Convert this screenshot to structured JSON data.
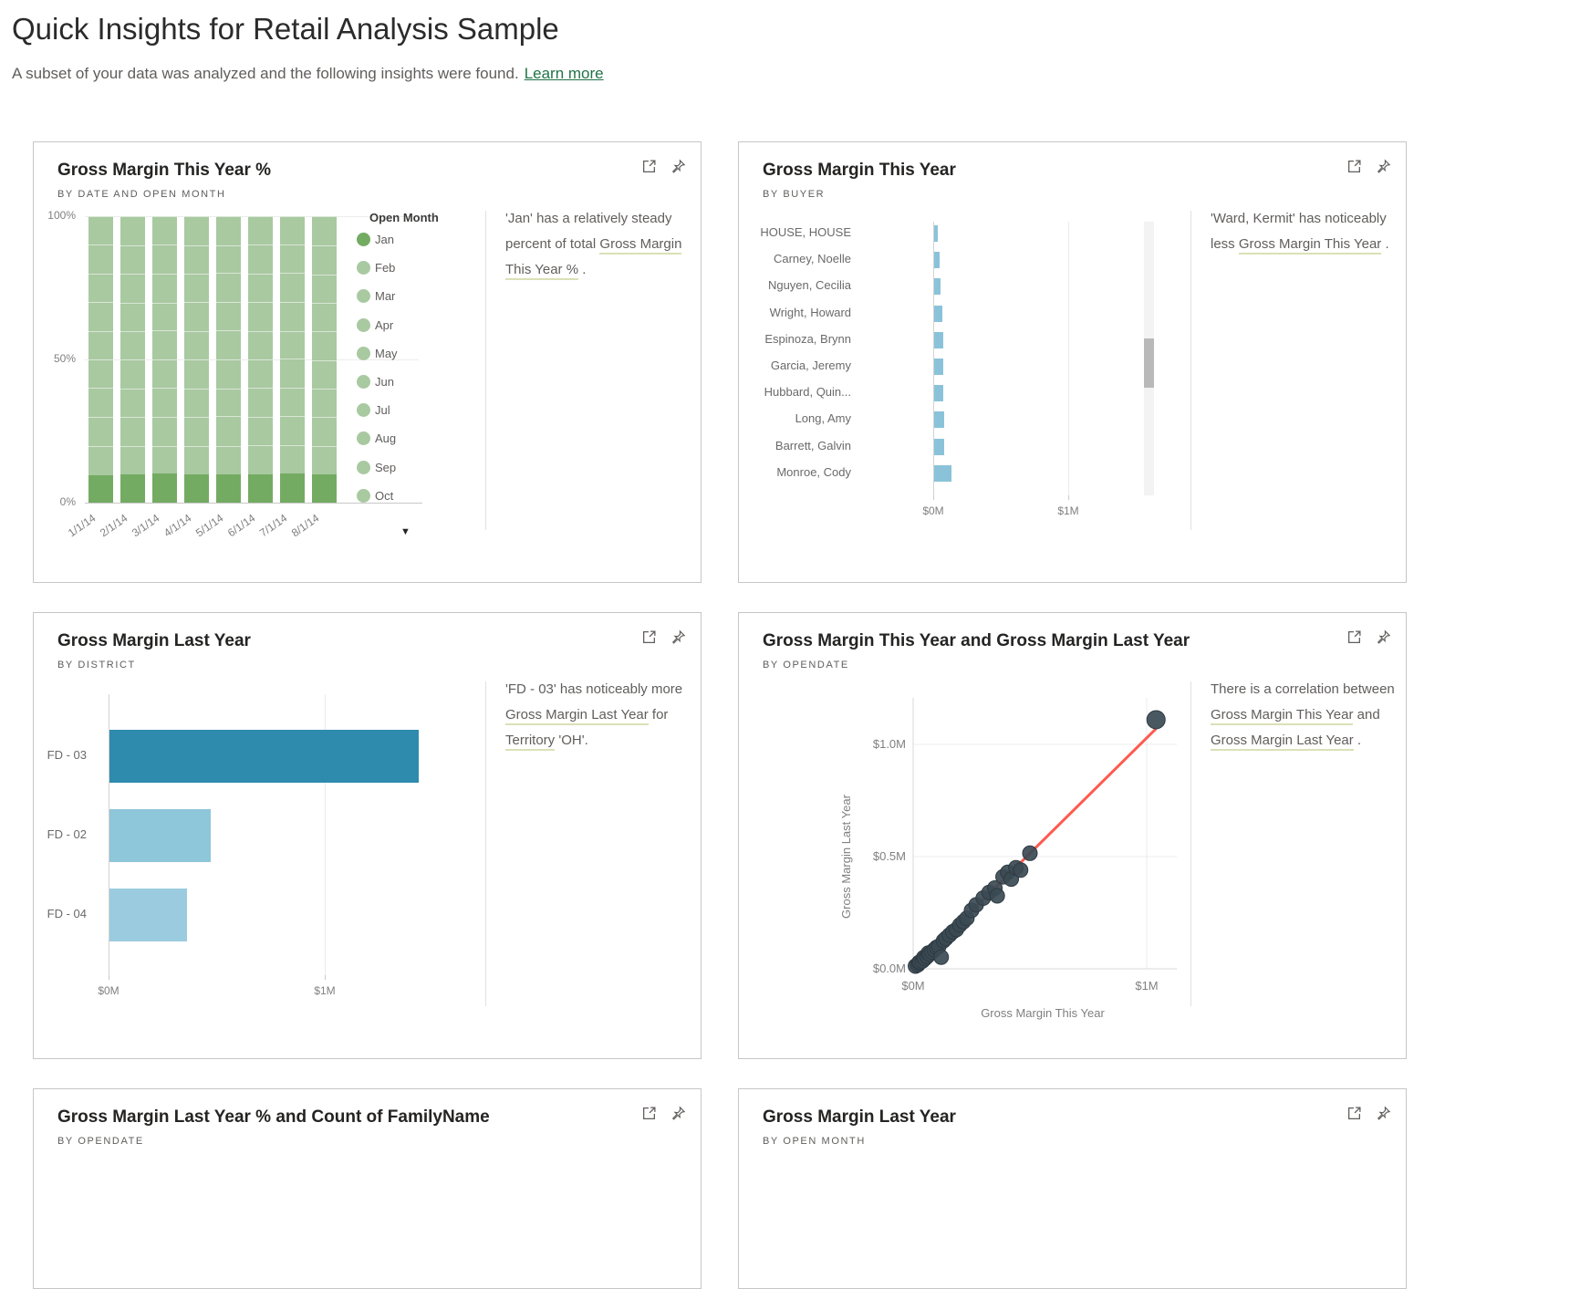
{
  "page": {
    "title": "Quick Insights for Retail Analysis Sample",
    "subtitle": "A subset of your data was analyzed and the following insights were found.",
    "learn_more_label": "Learn more"
  },
  "cards": [
    {
      "title": "Gross Margin This Year %",
      "subtitle": "BY DATE AND OPEN MONTH",
      "insight": [
        {
          "t": "'Jan' has a relatively steady percent of total "
        },
        {
          "t": "Gross Margin This Year %",
          "u": true
        },
        {
          "t": " ."
        }
      ],
      "chart_data": {
        "type": "bar",
        "subtype": "stacked-100",
        "categories": [
          "1/1/14",
          "2/1/14",
          "3/1/14",
          "4/1/14",
          "5/1/14",
          "6/1/14",
          "7/1/14",
          "8/1/14"
        ],
        "legend_title": "Open Month",
        "series": [
          "Jan",
          "Feb",
          "Mar",
          "Apr",
          "May",
          "Jun",
          "Jul",
          "Aug",
          "Sep",
          "Oct"
        ],
        "legend_has_more": true,
        "legend_more_glyph": "▼",
        "yticks": [
          "100%",
          "50%",
          "0%"
        ],
        "highlight_series": "Jan",
        "highlight_color": "#74ab63",
        "base_color": "#a9c9a1",
        "segments_pct": [
          [
            9.7,
            10.2,
            9.9,
            10.3,
            10.0,
            9.8,
            10.1,
            9.9,
            10.2,
            9.9
          ],
          [
            9.9,
            10.0,
            10.1,
            9.8,
            10.2,
            10.0,
            9.9,
            10.1,
            9.8,
            10.2
          ],
          [
            10.1,
            9.8,
            10.0,
            10.2,
            9.9,
            10.1,
            9.8,
            10.0,
            10.2,
            9.9
          ],
          [
            9.8,
            10.1,
            9.9,
            10.0,
            10.1,
            9.9,
            10.2,
            9.8,
            10.0,
            10.2
          ],
          [
            10.0,
            9.9,
            10.2,
            9.8,
            10.0,
            10.2,
            9.9,
            10.1,
            9.8,
            10.1
          ],
          [
            9.9,
            10.2,
            9.8,
            10.1,
            9.9,
            10.0,
            10.1,
            9.9,
            10.2,
            9.9
          ],
          [
            10.2,
            9.8,
            10.1,
            9.9,
            10.2,
            9.8,
            10.0,
            10.2,
            9.8,
            10.0
          ],
          [
            9.8,
            10.0,
            10.0,
            10.1,
            9.8,
            10.2,
            10.0,
            9.8,
            10.1,
            10.2
          ]
        ]
      }
    },
    {
      "title": "Gross Margin This Year",
      "subtitle": "BY BUYER",
      "insight": [
        {
          "t": "'Ward, Kermit' has noticeably less "
        },
        {
          "t": "Gross Margin This Year",
          "u": true
        },
        {
          "t": " ."
        }
      ],
      "chart_data": {
        "type": "bar",
        "subtype": "horizontal",
        "categories": [
          "HOUSE, HOUSE",
          "Carney, Noelle",
          "Nguyen, Cecilia",
          "Wright, Howard",
          "Espinoza, Brynn",
          "Garcia, Jeremy",
          "Hubbard, Quin...",
          "Long, Amy",
          "Barrett, Galvin",
          "Monroe, Cody"
        ],
        "values_m": [
          0.03,
          0.04,
          0.05,
          0.06,
          0.065,
          0.07,
          0.07,
          0.075,
          0.075,
          0.13
        ],
        "bar_color": "#8ac3d9",
        "xticks": [
          "$0M",
          "$1M"
        ],
        "has_scrollbar": true
      }
    },
    {
      "title": "Gross Margin Last Year",
      "subtitle": "BY DISTRICT",
      "insight": [
        {
          "t": "'FD - 03' has noticeably more "
        },
        {
          "t": "Gross Margin Last Year",
          "u": true
        },
        {
          "t": " for "
        },
        {
          "t": "Territory",
          "u": true
        },
        {
          "t": " 'OH'."
        }
      ],
      "chart_data": {
        "type": "bar",
        "subtype": "horizontal",
        "categories": [
          "FD - 03",
          "FD - 02",
          "FD - 04"
        ],
        "values_m": [
          1.43,
          0.47,
          0.36
        ],
        "bar_colors": [
          "#2e8bad",
          "#8ec6da",
          "#9acbde"
        ],
        "xticks": [
          "$0M",
          "$1M"
        ],
        "has_scrollbar": false
      }
    },
    {
      "title": "Gross Margin This Year and Gross Margin Last Year",
      "subtitle": "BY OPENDATE",
      "insight": [
        {
          "t": "There is a correlation between "
        },
        {
          "t": "Gross Margin This Year",
          "u": true
        },
        {
          "t": " and "
        },
        {
          "t": "Gross Margin Last Year",
          "u": true
        },
        {
          "t": " ."
        }
      ],
      "chart_data": {
        "type": "scatter",
        "xlabel": "Gross Margin This Year",
        "ylabel": "Gross Margin Last Year",
        "xticks": [
          {
            "label": "$0M",
            "v": 0
          },
          {
            "label": "$1M",
            "v": 1
          }
        ],
        "yticks": [
          {
            "label": "$0.0M",
            "v": 0
          },
          {
            "label": "$0.5M",
            "v": 0.5
          },
          {
            "label": "$1.0M",
            "v": 1.0
          }
        ],
        "dot_color": "#3b4a54",
        "trend_color": "#fd5a4e",
        "trendline": {
          "from": [
            0.01,
            0.01
          ],
          "to": [
            1.04,
            1.07
          ]
        },
        "points": [
          [
            0.01,
            0.012
          ],
          [
            0.02,
            0.018
          ],
          [
            0.025,
            0.028
          ],
          [
            0.03,
            0.03
          ],
          [
            0.04,
            0.035
          ],
          [
            0.045,
            0.05
          ],
          [
            0.05,
            0.045
          ],
          [
            0.06,
            0.055
          ],
          [
            0.065,
            0.07
          ],
          [
            0.07,
            0.065
          ],
          [
            0.08,
            0.075
          ],
          [
            0.09,
            0.085
          ],
          [
            0.1,
            0.095
          ],
          [
            0.11,
            0.1
          ],
          [
            0.12,
            0.052
          ],
          [
            0.13,
            0.125
          ],
          [
            0.14,
            0.135
          ],
          [
            0.155,
            0.15
          ],
          [
            0.17,
            0.165
          ],
          [
            0.185,
            0.175
          ],
          [
            0.2,
            0.195
          ],
          [
            0.215,
            0.21
          ],
          [
            0.23,
            0.225
          ],
          [
            0.25,
            0.26
          ],
          [
            0.27,
            0.285
          ],
          [
            0.3,
            0.315
          ],
          [
            0.325,
            0.34
          ],
          [
            0.35,
            0.36
          ],
          [
            0.36,
            0.325
          ],
          [
            0.385,
            0.41
          ],
          [
            0.405,
            0.43
          ],
          [
            0.42,
            0.4
          ],
          [
            0.44,
            0.45
          ],
          [
            0.46,
            0.44
          ],
          [
            0.5,
            0.515
          ],
          [
            1.04,
            1.11
          ]
        ]
      }
    },
    {
      "title": "Gross Margin Last Year % and Count of FamilyName",
      "subtitle": "BY OPENDATE"
    },
    {
      "title": "Gross Margin Last Year",
      "subtitle": "BY OPEN MONTH"
    }
  ]
}
